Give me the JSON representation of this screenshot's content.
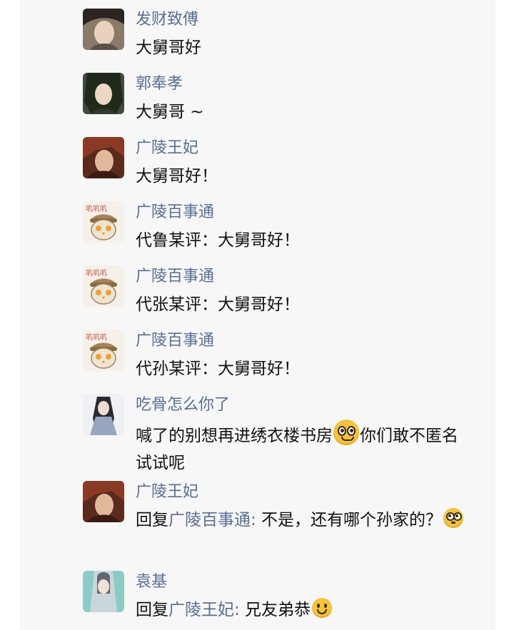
{
  "comments": [
    {
      "name": "发财致傅",
      "text": "大舅哥好"
    },
    {
      "name": "郭奉孝",
      "text": "大舅哥 ~"
    },
    {
      "name": "广陵王妃",
      "text": "大舅哥好！"
    },
    {
      "name": "广陵百事通",
      "text": "代鲁某评：大舅哥好！"
    },
    {
      "name": "广陵百事通",
      "text": "代张某评：大舅哥好！"
    },
    {
      "name": "广陵百事通",
      "text": "代孙某评：大舅哥好！"
    },
    {
      "name": "吃骨怎么你了",
      "text_before": "喊了的别想再进绣衣楼书房",
      "text_after": "你们敢不匿名试试呢",
      "emoji": "smirk-emoji-icon"
    },
    {
      "name": "广陵王妃",
      "reply_prefix": "回复",
      "reply_to": "广陵百事通:",
      "text": " 不是，还有哪个孙家的？",
      "emoji": "flushed-emoji-icon"
    },
    {
      "name": "袁基",
      "reply_prefix": "回复",
      "reply_to": "广陵王妃:",
      "text": " 兄友弟恭",
      "emoji": "smile-emoji-icon"
    }
  ],
  "colors": {
    "name": "#5a6e92",
    "text": "#111111",
    "panel": "#f7f7f8"
  }
}
